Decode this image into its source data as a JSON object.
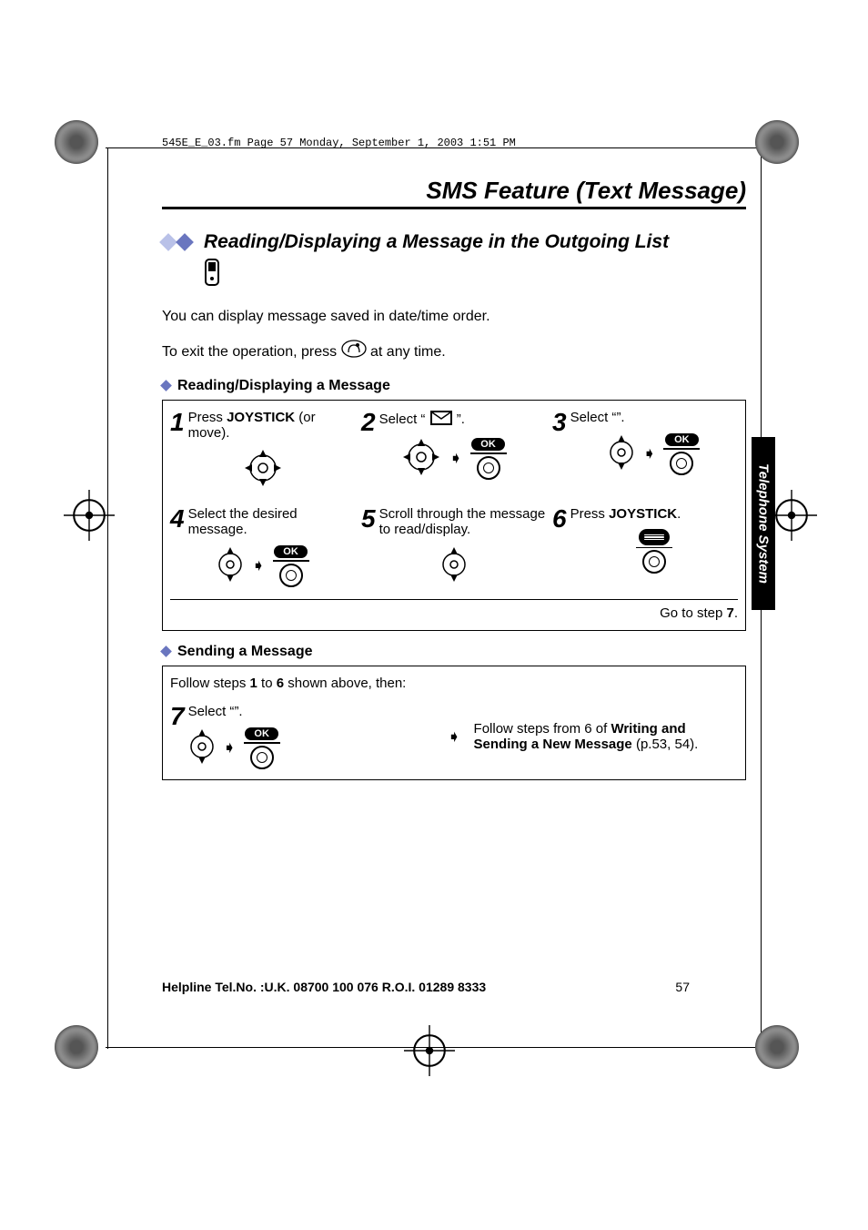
{
  "header_line": "545E_E_03.fm  Page 57  Monday, September 1, 2003  1:51 PM",
  "page_title": "SMS Feature (Text Message)",
  "section_title": "Reading/Displaying a Message in the Outgoing List",
  "intro_1": "You can display message saved in date/time order.",
  "intro_2a": "To exit the operation, press ",
  "intro_2b": " at any time.",
  "subhead_a": "Reading/Displaying a Message",
  "subhead_b": "Sending a Message",
  "steps": {
    "s1a": "Press ",
    "s1b": "JOYSTICK",
    "s1c": " (or move).",
    "s2a": "Select “",
    "s2b": "”.",
    "s3a": "Select “",
    "s3b": "”.",
    "s4": "Select the desired message.",
    "s5": "Scroll through the message to read/display.",
    "s6a": "Press ",
    "s6b": "JOYSTICK",
    "s6c": ".",
    "s7a": "Select “",
    "s7b": "”."
  },
  "ok_label": "OK",
  "goto_a": "Go to step ",
  "goto_b": "7",
  "goto_c": ".",
  "follow_intro": "Follow steps ",
  "follow_b1": "1",
  "follow_mid": " to ",
  "follow_b6": "6",
  "follow_end": " shown above, then:",
  "follow2_a": "Follow steps from 6 of ",
  "follow2_b": "Writing and Sending a New Message",
  "follow2_c": " (p.53, 54).",
  "sidebar": "Telephone System",
  "footer_help": "Helpline Tel.No. :U.K. 08700 100 076  R.O.I. 01289 8333",
  "page_num": "57"
}
